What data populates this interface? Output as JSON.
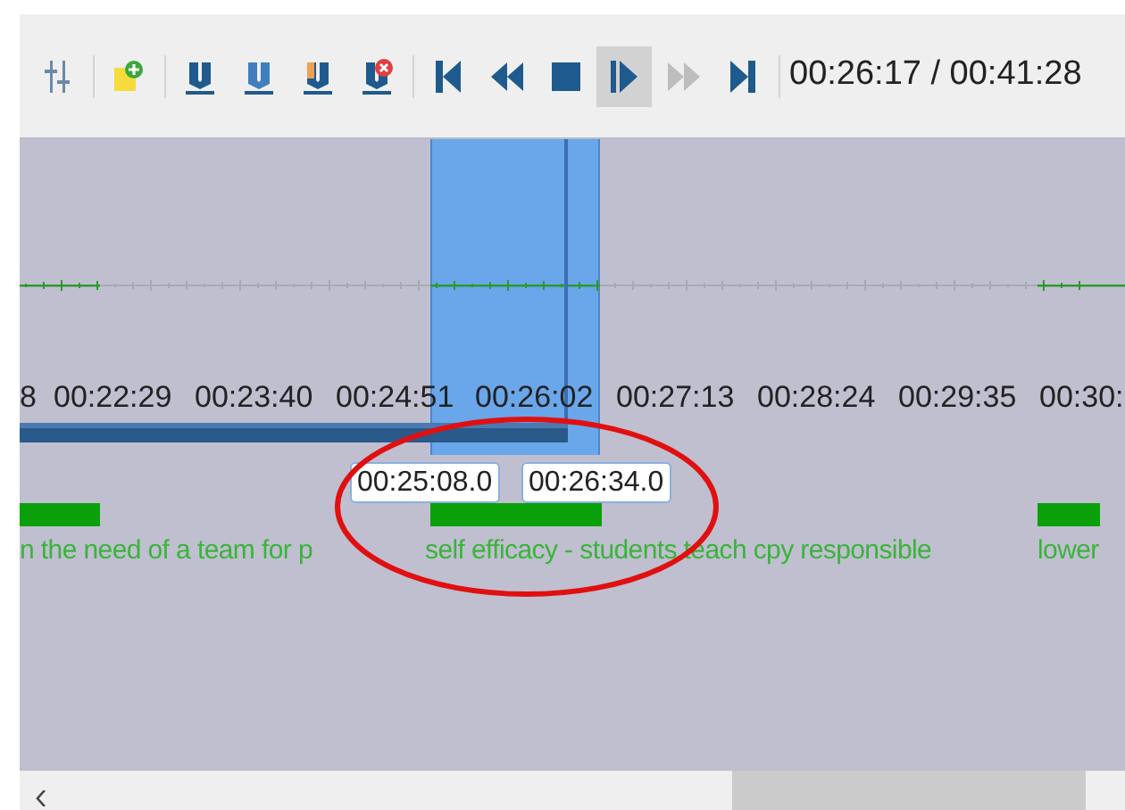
{
  "toolbar": {
    "buttons": [
      {
        "kind": "sliders",
        "selected": false,
        "disabled": false
      },
      {
        "kind": "add-note",
        "selected": false,
        "disabled": false
      },
      {
        "kind": "marker",
        "selected": false,
        "disabled": false
      },
      {
        "kind": "marker-light",
        "selected": false,
        "disabled": false
      },
      {
        "kind": "marker-orange",
        "selected": false,
        "disabled": false
      },
      {
        "kind": "marker-delete",
        "selected": false,
        "disabled": false
      },
      {
        "kind": "skip-start",
        "selected": false,
        "disabled": false
      },
      {
        "kind": "rewind",
        "selected": false,
        "disabled": false
      },
      {
        "kind": "stop",
        "selected": false,
        "disabled": false
      },
      {
        "kind": "play",
        "selected": true,
        "disabled": false
      },
      {
        "kind": "fast-forward",
        "selected": false,
        "disabled": true
      },
      {
        "kind": "skip-end",
        "selected": false,
        "disabled": false
      }
    ],
    "time_display": "00:26:17 / 00:41:28"
  },
  "timeline": {
    "ticks": [
      "8",
      "00:22:29",
      "00:23:40",
      "00:24:51",
      "00:26:02",
      "00:27:13",
      "00:28:24",
      "00:29:35",
      "00:30:"
    ],
    "playback": {
      "level": 0.496
    },
    "selection": {
      "start": "00:25:08.0",
      "end": "00:26:34.0"
    },
    "annotations": [
      {
        "text": "n the need of a team for p"
      },
      {
        "text": "self efficacy - students teach cpy responsible"
      },
      {
        "text": "lower"
      }
    ]
  }
}
